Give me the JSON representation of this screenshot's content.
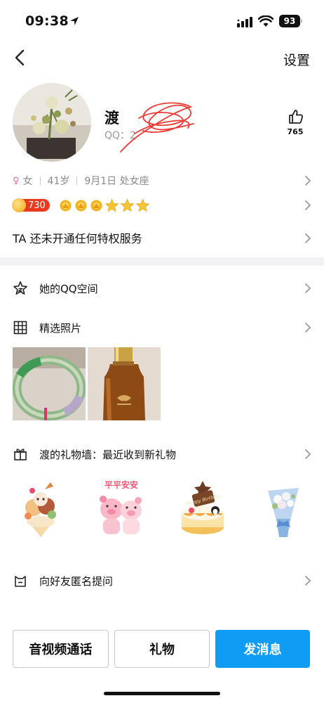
{
  "status": {
    "time": "09:38",
    "battery": "93"
  },
  "nav": {
    "settings_label": "设置"
  },
  "profile": {
    "nickname": "渡",
    "qq_label": "QQ：2",
    "likes": "765"
  },
  "info": {
    "gender": "女",
    "age": "41岁",
    "birthday": "9月1日 处女座"
  },
  "level": {
    "vip_number": "730",
    "crowns": 3,
    "stars": 3
  },
  "privilege": {
    "text": "TA 还未开通任何特权服务"
  },
  "menu": {
    "qzone": "她的QQ空间",
    "photos": "精选照片",
    "gift_wall": "渡的礼物墙：最近收到新礼物",
    "anon_question": "向好友匿名提问"
  },
  "photos": [
    "jade-bangle",
    "amber-bottle"
  ],
  "gifts": [
    {
      "name": "ice-cream-gift",
      "caption": ""
    },
    {
      "name": "pig-couple-gift",
      "caption": "平平安安"
    },
    {
      "name": "birthday-cake-gift",
      "caption": "Happy Birthday"
    },
    {
      "name": "flower-bouquet-gift",
      "caption": ""
    }
  ],
  "buttons": {
    "call": "音视频通话",
    "gift": "礼物",
    "message": "发消息"
  },
  "colors": {
    "primary": "#0f9cf5",
    "vip_red": "#e8391f",
    "scribble": "#ee3a34",
    "gender_pink": "#e86aa6"
  }
}
